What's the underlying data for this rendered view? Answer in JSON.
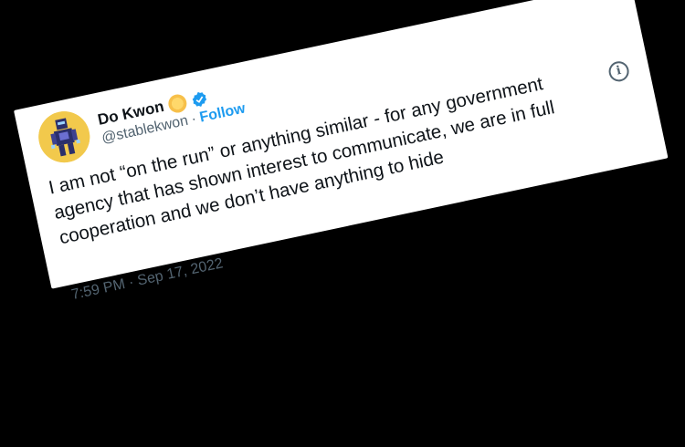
{
  "tweet": {
    "display_name": "Do Kwon",
    "handle": "@stablekwon",
    "separator": "·",
    "follow_label": "Follow",
    "text": "I am not “on the run” or anything similar - for any government agency that has shown interest to communicate, we are in full cooperation and we don’t have anything to hide",
    "timestamp": "7:59 PM · Sep 17, 2022",
    "info_glyph": "i"
  },
  "icons": {
    "avatar": "avatar",
    "emoji": "sun-emoji-icon",
    "verified": "verified-badge-icon",
    "info": "info-icon"
  },
  "colors": {
    "background": "#000000",
    "card": "#ffffff",
    "text": "#0f1419",
    "secondary": "#536471",
    "accent": "#1d9bf0"
  }
}
